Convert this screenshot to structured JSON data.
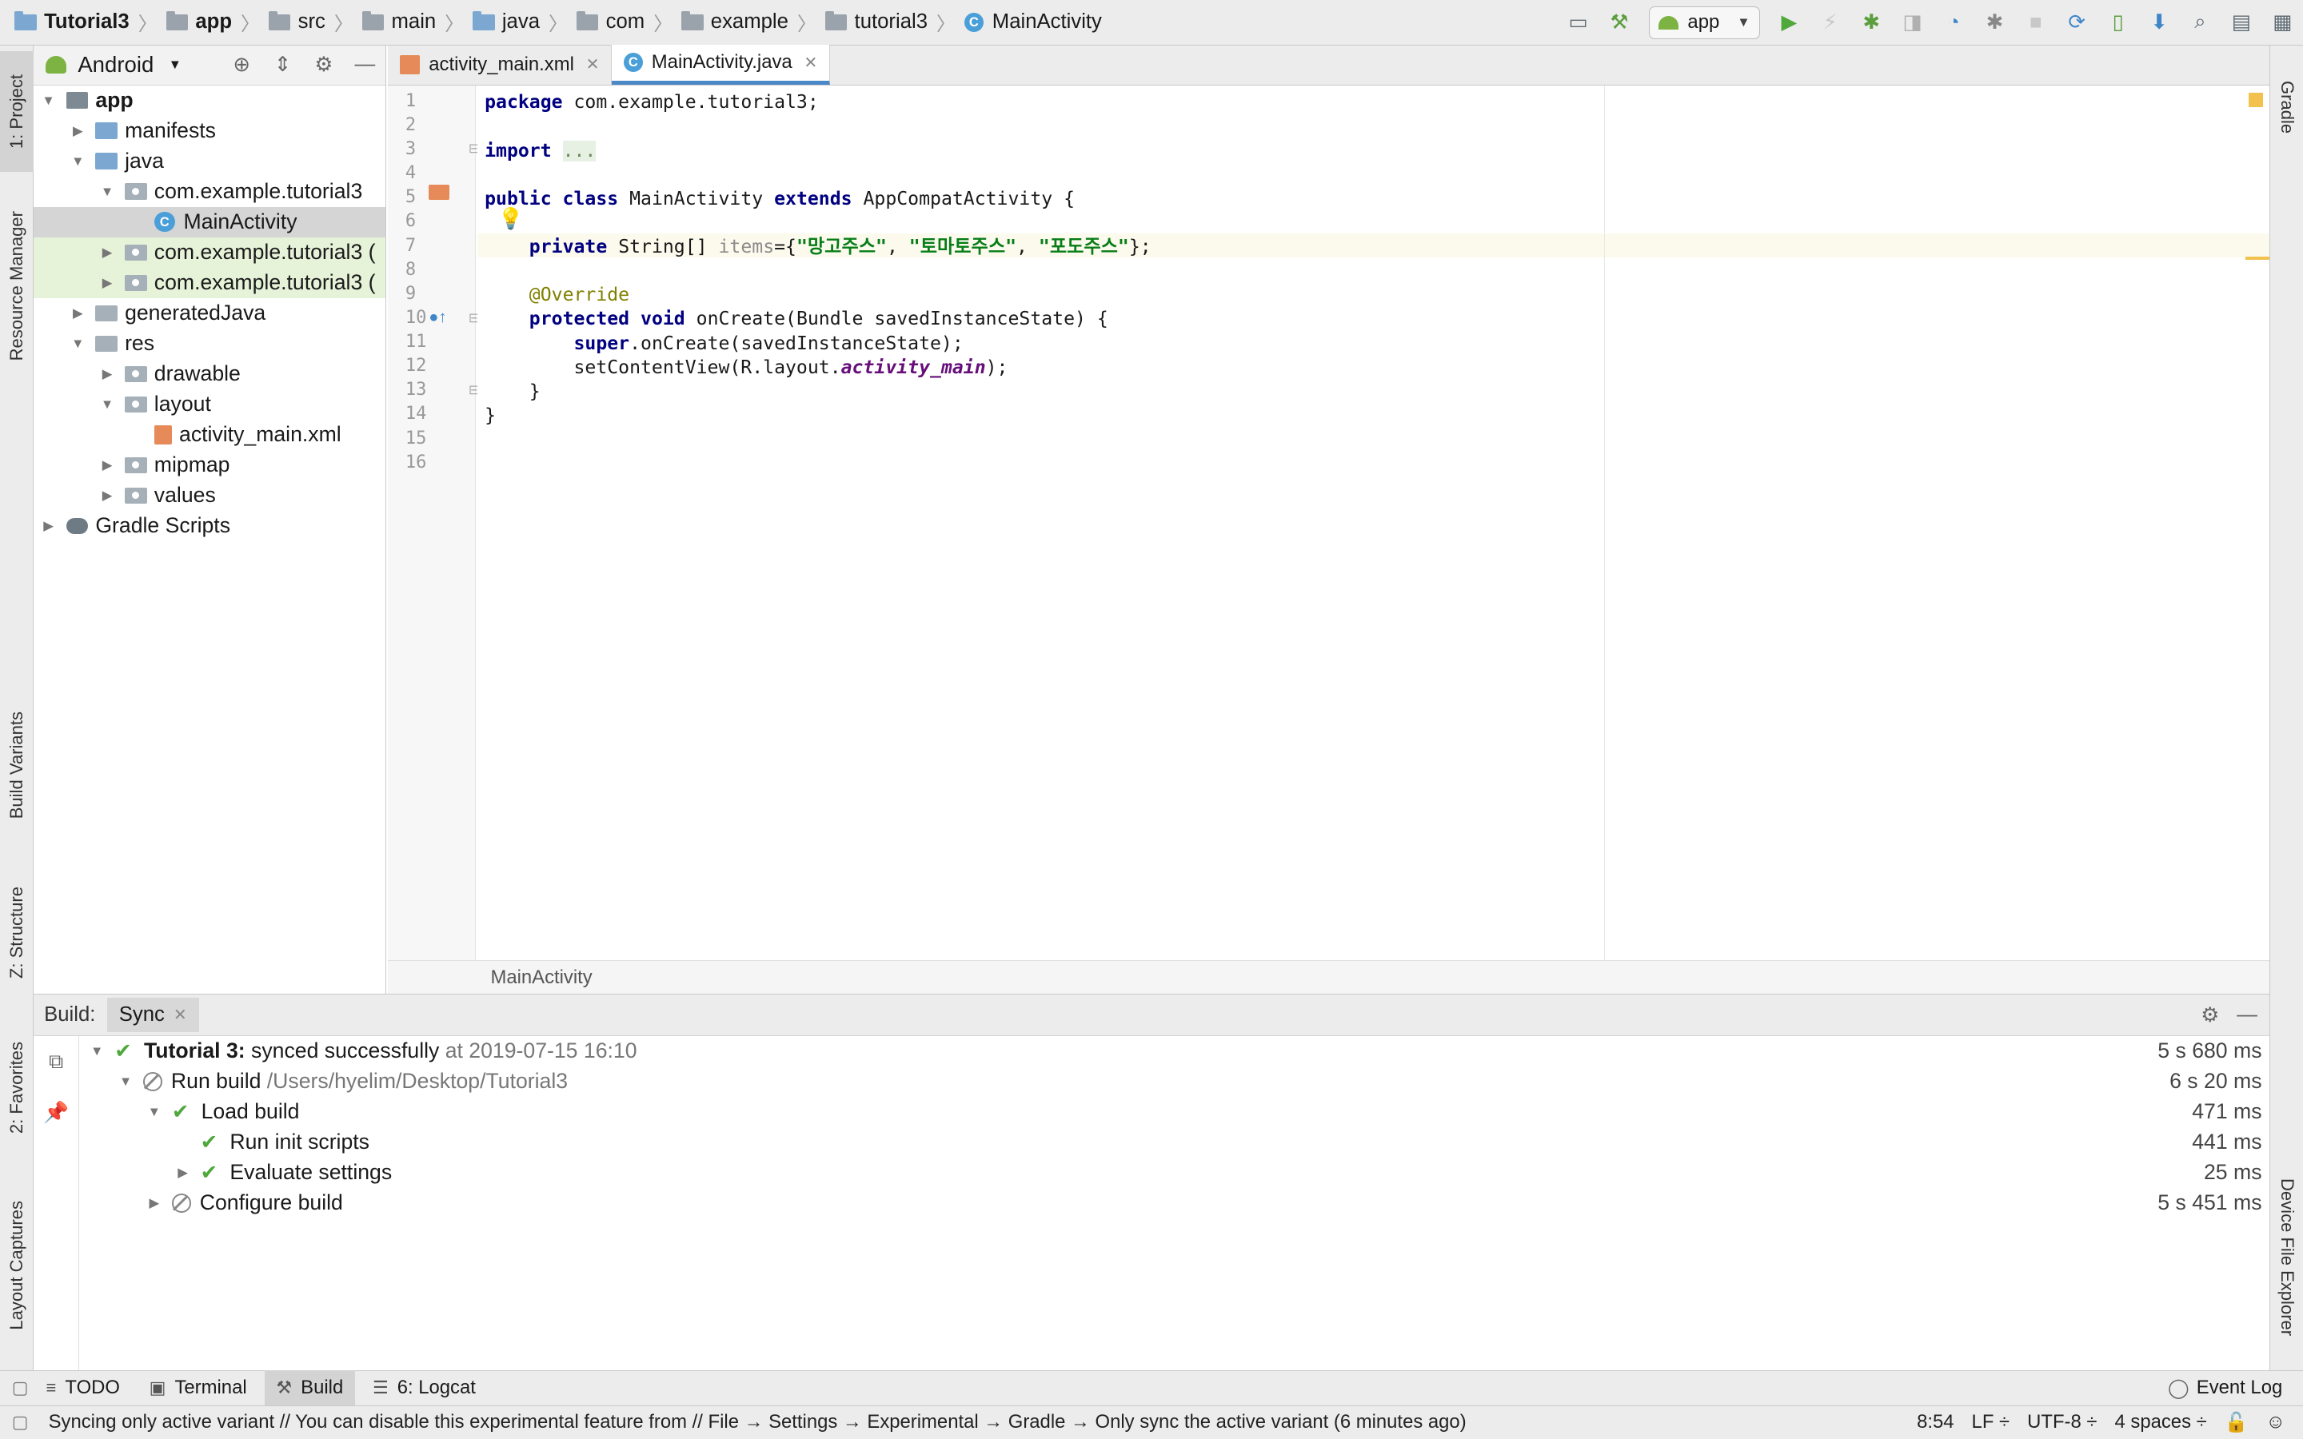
{
  "breadcrumb": [
    "Tutorial3",
    "app",
    "src",
    "main",
    "java",
    "com",
    "example",
    "tutorial3",
    "MainActivity"
  ],
  "toolbar": {
    "run_config": "app"
  },
  "left_strip": [
    "1: Project",
    "Resource Manager",
    "Build Variants",
    "Z: Structure",
    "2: Favorites",
    "Layout Captures"
  ],
  "right_strip": [
    "Gradle",
    "Device File Explorer"
  ],
  "project_panel": {
    "view_mode": "Android",
    "tree": [
      {
        "label": "app",
        "depth": 0,
        "expanded": true,
        "bold": true,
        "icon": "module-icon"
      },
      {
        "label": "manifests",
        "depth": 1,
        "expanded": false,
        "icon": "folder-icon"
      },
      {
        "label": "java",
        "depth": 1,
        "expanded": true,
        "icon": "folder-icon"
      },
      {
        "label": "com.example.tutorial3",
        "depth": 2,
        "expanded": true,
        "icon": "package-icon"
      },
      {
        "label": "MainActivity",
        "depth": 3,
        "selected": true,
        "icon": "class-icon"
      },
      {
        "label": "com.example.tutorial3 (",
        "depth": 2,
        "expanded": false,
        "green": true,
        "icon": "package-icon"
      },
      {
        "label": "com.example.tutorial3 (",
        "depth": 2,
        "expanded": false,
        "green": true,
        "icon": "package-icon"
      },
      {
        "label": "generatedJava",
        "depth": 1,
        "expanded": false,
        "icon": "generated-folder-icon"
      },
      {
        "label": "res",
        "depth": 1,
        "expanded": true,
        "icon": "res-folder-icon"
      },
      {
        "label": "drawable",
        "depth": 2,
        "expanded": false,
        "icon": "package-icon"
      },
      {
        "label": "layout",
        "depth": 2,
        "expanded": true,
        "icon": "package-icon"
      },
      {
        "label": "activity_main.xml",
        "depth": 3,
        "icon": "xml-file-icon"
      },
      {
        "label": "mipmap",
        "depth": 2,
        "expanded": false,
        "icon": "package-icon"
      },
      {
        "label": "values",
        "depth": 2,
        "expanded": false,
        "icon": "package-icon"
      },
      {
        "label": "Gradle Scripts",
        "depth": 0,
        "expanded": false,
        "icon": "gradle-icon"
      }
    ]
  },
  "editor": {
    "tabs": [
      {
        "label": "activity_main.xml",
        "active": false
      },
      {
        "label": "MainActivity.java",
        "active": true
      }
    ],
    "line_numbers": [
      "1",
      "2",
      "3",
      "4",
      "5",
      "6",
      "7",
      "8",
      "9",
      "10",
      "11",
      "12",
      "13",
      "14",
      "15",
      "16"
    ],
    "footer_breadcrumb": "MainActivity"
  },
  "build": {
    "title": "Build:",
    "tab": "Sync",
    "rows": [
      {
        "depth": 0,
        "status": "ok",
        "expanded": true,
        "bold": "Tutorial 3:",
        "text": " synced successfully",
        "gray": "at 2019-07-15 16:10",
        "duration": "5 s 680 ms"
      },
      {
        "depth": 1,
        "status": "skip",
        "expanded": true,
        "bold": "",
        "text": "Run build",
        "gray": "/Users/hyelim/Desktop/Tutorial3",
        "duration": "6 s 20 ms"
      },
      {
        "depth": 2,
        "status": "ok",
        "expanded": true,
        "bold": "",
        "text": "Load build",
        "gray": "",
        "duration": "471 ms"
      },
      {
        "depth": 3,
        "status": "ok",
        "expanded": null,
        "bold": "",
        "text": "Run init scripts",
        "gray": "",
        "duration": "441 ms"
      },
      {
        "depth": 3,
        "status": "ok",
        "expanded": false,
        "bold": "",
        "text": "Evaluate settings",
        "gray": "",
        "duration": "25 ms"
      },
      {
        "depth": 2,
        "status": "skip",
        "expanded": false,
        "bold": "",
        "text": "Configure build",
        "gray": "",
        "duration": "5 s 451 ms"
      }
    ]
  },
  "tool_tabs": [
    {
      "label": "TODO",
      "icon": "list-icon",
      "active": false
    },
    {
      "label": "Terminal",
      "icon": "terminal-icon",
      "active": false
    },
    {
      "label": "Build",
      "icon": "hammer-icon",
      "active": true
    },
    {
      "label": "6: Logcat",
      "icon": "logcat-icon",
      "active": false
    }
  ],
  "event_log": "Event Log",
  "status_bar": {
    "message": "Syncing only active variant // You can disable this experimental feature from // File → Settings → Experimental → Gradle → Only sync the active variant (6 minutes ago)",
    "position": "8:54",
    "line_sep": "LF ÷",
    "encoding": "UTF-8 ÷",
    "indent": "4 spaces ÷"
  },
  "colors": {
    "accent": "#4a88c7",
    "ok": "#4fa83c",
    "keyword": "#000080",
    "string": "#067d17"
  }
}
